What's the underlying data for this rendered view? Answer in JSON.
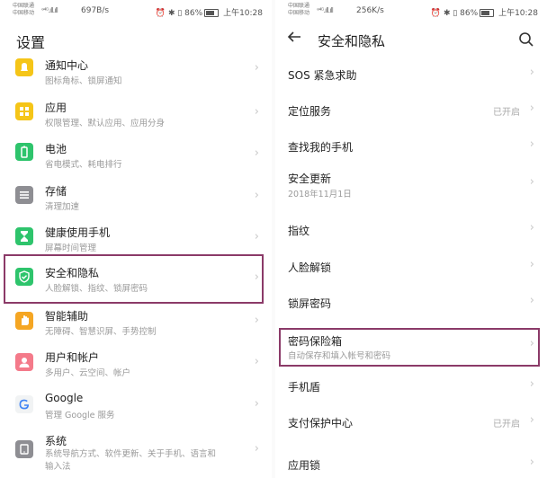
{
  "left": {
    "status": {
      "carrier1": "中国联通",
      "carrier2": "中国移动",
      "signal": "ᵊ⁴ᴳ.ıll.ıll",
      "speed": "697B/s",
      "icons": "⏰ ✱ ▯",
      "battery": "86%",
      "time": "上午10:28"
    },
    "title": "设置",
    "items": [
      {
        "title": "通知中心",
        "sub": "图标角标、锁屏通知",
        "icon": "bell-icon",
        "color": "#f5c518"
      },
      {
        "title": "应用",
        "sub": "权限管理、默认应用、应用分身",
        "icon": "apps-grid-icon",
        "color": "#f5c518"
      },
      {
        "title": "电池",
        "sub": "省电模式、耗电排行",
        "icon": "battery-icon",
        "color": "#2ec46c"
      },
      {
        "title": "存储",
        "sub": "清理加速",
        "icon": "storage-icon",
        "color": "#8e8e93"
      },
      {
        "title": "健康使用手机",
        "sub": "屏幕时间管理",
        "icon": "hourglass-icon",
        "color": "#2ec46c"
      },
      {
        "title": "安全和隐私",
        "sub": "人脸解锁、指纹、锁屏密码",
        "icon": "shield-icon",
        "color": "#2ec46c"
      },
      {
        "title": "智能辅助",
        "sub": "无障碍、智慧识屏、手势控制",
        "icon": "hand-icon",
        "color": "#f5a623"
      },
      {
        "title": "用户和帐户",
        "sub": "多用户、云空间、帐户",
        "icon": "user-icon",
        "color": "#f47a8a"
      },
      {
        "title": "Google",
        "sub": "管理 Google 服务",
        "icon": "google-icon",
        "color": "#4285f4"
      },
      {
        "title": "系统",
        "sub": "系统导航方式、软件更新、关于手机、语言和输入法",
        "icon": "system-icon",
        "color": "#8e8e93"
      }
    ]
  },
  "right": {
    "status": {
      "carrier1": "中国联通",
      "carrier2": "中国移动",
      "signal": "ᵊ⁴ᴳ.ıll.ıll",
      "speed": "256K/s",
      "icons": "⏰ ✱ ▯",
      "battery": "86%",
      "time": "上午10:28"
    },
    "title": "安全和隐私",
    "items": [
      {
        "title": "SOS 紧急求助",
        "sub": "",
        "value": ""
      },
      {
        "title": "定位服务",
        "sub": "",
        "value": "已开启"
      },
      {
        "title": "查找我的手机",
        "sub": "",
        "value": ""
      },
      {
        "title": "安全更新",
        "sub": "2018年11月1日",
        "value": ""
      },
      {
        "title": "指纹",
        "sub": "",
        "value": ""
      },
      {
        "title": "人脸解锁",
        "sub": "",
        "value": ""
      },
      {
        "title": "锁屏密码",
        "sub": "",
        "value": ""
      },
      {
        "title": "密码保险箱",
        "sub": "自动保存和填入帐号和密码",
        "value": ""
      },
      {
        "title": "手机盾",
        "sub": "",
        "value": ""
      },
      {
        "title": "支付保护中心",
        "sub": "",
        "value": "已开启"
      },
      {
        "title": "应用锁",
        "sub": "",
        "value": ""
      }
    ]
  }
}
